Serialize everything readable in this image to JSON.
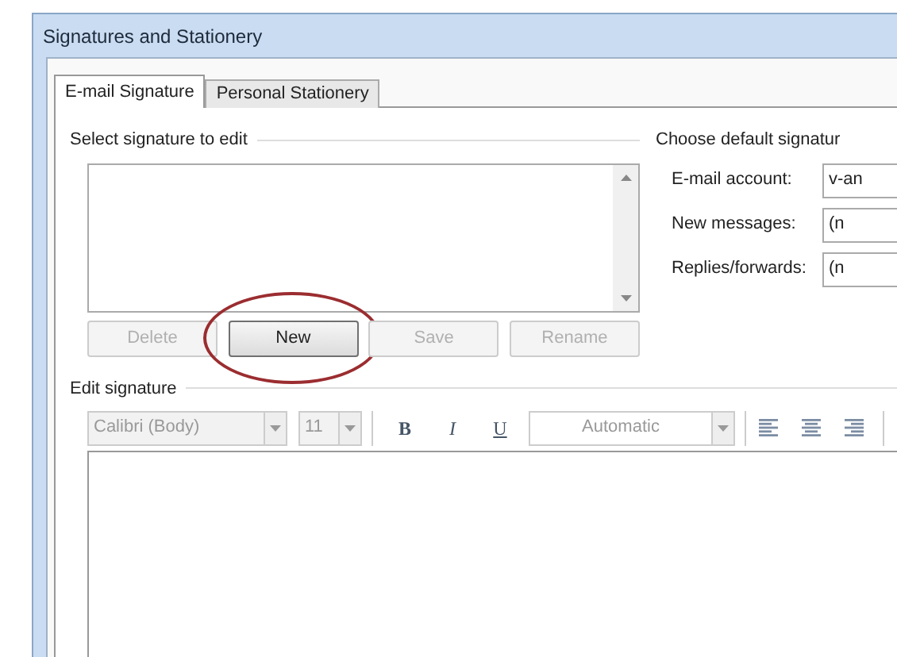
{
  "window": {
    "title": "Signatures and Stationery"
  },
  "tabs": [
    {
      "label": "E-mail Signature",
      "selected": true
    },
    {
      "label": "Personal Stationery",
      "selected": false
    }
  ],
  "select_group": {
    "label": "Select signature to edit",
    "buttons": [
      {
        "label": "Delete",
        "disabled": true,
        "circled": false
      },
      {
        "label": "New",
        "disabled": false,
        "circled": true
      },
      {
        "label": "Save",
        "disabled": true,
        "circled": false
      },
      {
        "label": "Rename",
        "disabled": true,
        "circled": false
      }
    ]
  },
  "default_group": {
    "label": "Choose default signatur",
    "fields": [
      {
        "label": "E-mail account:",
        "value": "v-an"
      },
      {
        "label": "New messages:",
        "value": "(n"
      },
      {
        "label": "Replies/forwards:",
        "value": "(n"
      }
    ]
  },
  "edit_group": {
    "label": "Edit signature",
    "font": "Calibri (Body)",
    "size": "11",
    "bold": "B",
    "italic": "I",
    "underline": "U",
    "font_color": "Automatic"
  }
}
